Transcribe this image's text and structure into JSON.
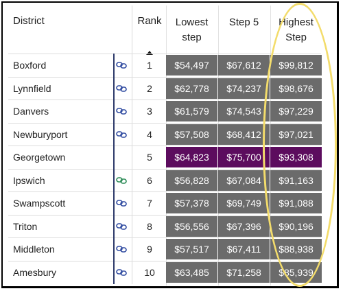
{
  "table": {
    "headers": {
      "district": "District",
      "rank": "Rank",
      "lowest_line1": "Lowest",
      "lowest_line2": "step",
      "step5": "Step 5",
      "highest_line1": "Highest",
      "highest_line2": "Step"
    },
    "sort": {
      "column": "Rank",
      "direction": "ascending"
    },
    "rows": [
      {
        "district": "Boxford",
        "link_icon_color": "#2f4aa0",
        "rank": "1",
        "lowest": "$54,497",
        "step5": "$67,612",
        "highest": "$99,812",
        "highlight": false
      },
      {
        "district": "Lynnfield",
        "link_icon_color": "#2f4aa0",
        "rank": "2",
        "lowest": "$62,778",
        "step5": "$74,237",
        "highest": "$98,676",
        "highlight": false
      },
      {
        "district": "Danvers",
        "link_icon_color": "#2f4aa0",
        "rank": "3",
        "lowest": "$61,579",
        "step5": "$74,543",
        "highest": "$97,229",
        "highlight": false
      },
      {
        "district": "Newburyport",
        "link_icon_color": "#2f4aa0",
        "rank": "4",
        "lowest": "$57,508",
        "step5": "$68,412",
        "highest": "$97,021",
        "highlight": false
      },
      {
        "district": "Georgetown",
        "link_icon_color": "",
        "rank": "5",
        "lowest": "$64,823",
        "step5": "$75,700",
        "highest": "$93,308",
        "highlight": true
      },
      {
        "district": "Ipswich",
        "link_icon_color": "#2a8a55",
        "rank": "6",
        "lowest": "$56,828",
        "step5": "$67,084",
        "highest": "$91,163",
        "highlight": false
      },
      {
        "district": "Swampscott",
        "link_icon_color": "#2f4aa0",
        "rank": "7",
        "lowest": "$57,378",
        "step5": "$69,749",
        "highest": "$91,088",
        "highlight": false
      },
      {
        "district": "Triton",
        "link_icon_color": "#2f4aa0",
        "rank": "8",
        "lowest": "$56,556",
        "step5": "$67,396",
        "highest": "$90,196",
        "highlight": false
      },
      {
        "district": "Middleton",
        "link_icon_color": "#2f4aa0",
        "rank": "9",
        "lowest": "$57,517",
        "step5": "$67,411",
        "highest": "$88,938",
        "highlight": false
      },
      {
        "district": "Amesbury",
        "link_icon_color": "#2f4aa0",
        "rank": "10",
        "lowest": "$63,485",
        "step5": "$71,258",
        "highest": "$85,939",
        "highlight": false
      }
    ]
  },
  "colors": {
    "cell_default": "#6b6b6b",
    "cell_highlight": "#5c0c5e",
    "annotation_oval": "#f3dc6b"
  }
}
